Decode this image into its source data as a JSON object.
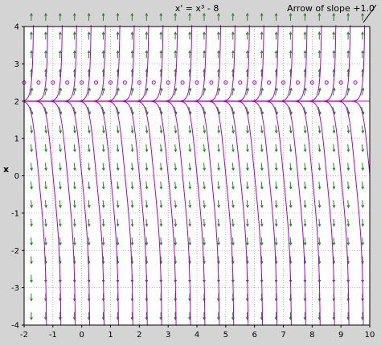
{
  "chart_data": {
    "type": "direction-field",
    "title": "x' = x³ - 8",
    "annotation": "Arrow of slope +1.0",
    "ylabel": "x",
    "xlabel": "",
    "xlim": [
      -2,
      10
    ],
    "ylim": [
      -4,
      4
    ],
    "x_ticks": [
      "-2",
      "-1",
      "0",
      "1",
      "2",
      "3",
      "4",
      "5",
      "6",
      "7",
      "8",
      "9",
      "10"
    ],
    "y_ticks": [
      "4",
      "3",
      "2",
      "1",
      "0",
      "-1",
      "-2",
      "-3",
      "-4"
    ],
    "equilibrium_x": 2,
    "grid": true,
    "solution_curve_start_t": [
      -2,
      -1.5,
      -1,
      -0.5,
      0,
      0.5,
      1,
      1.5,
      2,
      2.5,
      3,
      3.5,
      4,
      4.5,
      5,
      5.5,
      6,
      6.5,
      7,
      7.5,
      8,
      8.5,
      9,
      9.5
    ],
    "colors": {
      "background": "#d4d4d4",
      "plot_background": "#ffffff",
      "grid": "#8c8c8c",
      "arrow": "#1c8c1c",
      "solution": "#b400c8",
      "marker": "#b400c8"
    }
  }
}
